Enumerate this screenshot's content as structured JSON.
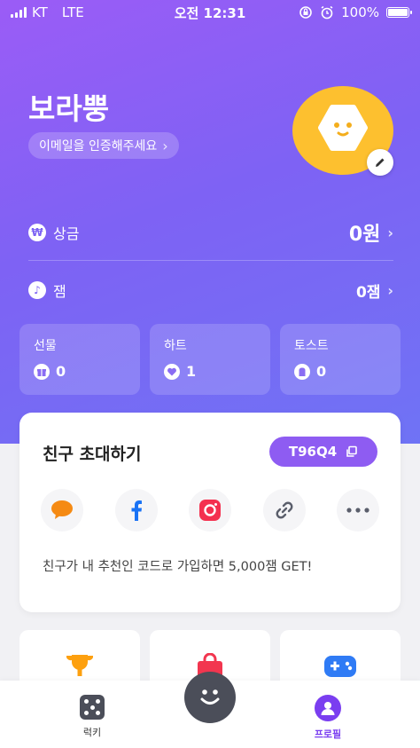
{
  "status": {
    "carrier": "KT",
    "network": "LTE",
    "time": "오전 12:31",
    "battery": "100%",
    "battery_level": 1.0
  },
  "profile": {
    "name": "보라뿡",
    "verify_label": "이메일을 인증해주세요",
    "avatar_color": "#fdc02f"
  },
  "rewards": {
    "prize_label": "상금",
    "prize_value": "0원",
    "jam_label": "잼",
    "jam_value": "0잼"
  },
  "stats": [
    {
      "label": "선물",
      "value": "0"
    },
    {
      "label": "하트",
      "value": "1"
    },
    {
      "label": "토스트",
      "value": "0"
    }
  ],
  "invite": {
    "title": "친구 초대하기",
    "code": "T96Q4",
    "description": "친구가 내 추천인 코드로 가입하면 5,000잼 GET!",
    "share_icons": [
      "kakaotalk-icon",
      "facebook-icon",
      "instagram-icon",
      "link-icon",
      "more-icon"
    ]
  },
  "tabs": {
    "lucky": "럭키",
    "profile": "프로필"
  },
  "colors": {
    "accent": "#8e5cf2",
    "gradient_start": "#9b5cf6",
    "gradient_end": "#6f73f5"
  }
}
